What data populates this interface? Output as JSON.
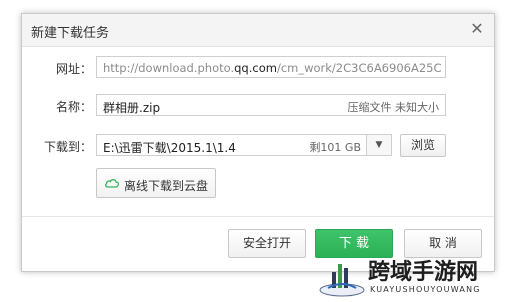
{
  "dialog": {
    "title": "新建下载任务",
    "close_glyph": "✕"
  },
  "form": {
    "url_label": "网址：",
    "url_prefix": "http://download.photo.",
    "url_highlight": "qq.com",
    "url_suffix": "/cm_work/2C3C6A6906A25C",
    "name_label": "名称：",
    "name_value": "群相册.zip",
    "name_meta": "压缩文件 未知大小",
    "path_label": "下载到：",
    "path_value": "E:\\迅雷下载\\2015.1\\1.4",
    "path_free": "剩101 GB",
    "path_dropdown_glyph": "▼",
    "browse_label": "浏览",
    "cloud_label": "离线下载到云盘"
  },
  "footer": {
    "safe_open_label": "安全打开",
    "download_label": "下 载",
    "cancel_label": "取 消"
  },
  "watermark": {
    "title": "跨域手游网",
    "subtitle": "KUAYUSHOUYOUWANG"
  },
  "colors": {
    "primary_green": "#2bb156",
    "url_gray": "#8c8c8c"
  }
}
